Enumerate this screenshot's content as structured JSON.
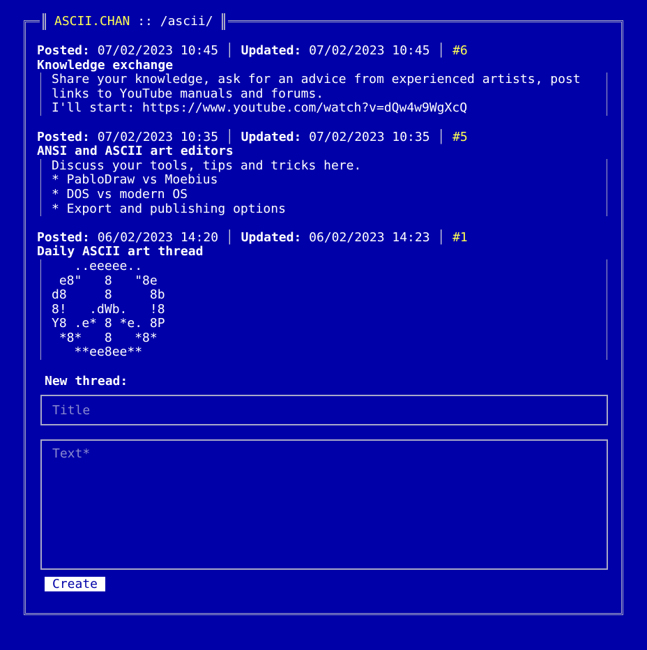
{
  "header": {
    "brand": "ASCII.CHAN",
    "separator": " :: ",
    "board": "/ascii/"
  },
  "labels": {
    "posted": "Posted:",
    "updated": "Updated:"
  },
  "threads": [
    {
      "posted": "07/02/2023 10:45",
      "updated": "07/02/2023 10:45",
      "number": "#6",
      "title": "Knowledge exchange",
      "body": "Share your knowledge, ask for an advice from experienced artists, post\nlinks to YouTube manuals and forums.\nI'll start: https://www.youtube.com/watch?v=dQw4w9WgXcQ"
    },
    {
      "posted": "07/02/2023 10:35",
      "updated": "07/02/2023 10:35",
      "number": "#5",
      "title": "ANSI and ASCII art editors",
      "body": "Discuss your tools, tips and tricks here.\n* PabloDraw vs Moebius\n* DOS vs modern OS\n* Export and publishing options"
    },
    {
      "posted": "06/02/2023 14:20",
      "updated": "06/02/2023 14:23",
      "number": "#1",
      "title": "Daily ASCII art thread",
      "body": "   ..eeeee..\n e8\"   8   \"8e\nd8     8     8b\n8!   .dWb.   !8\nY8 .e* 8 *e. 8P\n *8*   8   *8*\n   **ee8ee**"
    }
  ],
  "new_thread": {
    "label": "New thread:",
    "title_placeholder": "Title",
    "text_placeholder": "Text*",
    "create_label": "Create"
  },
  "colors": {
    "background": "#0000a8",
    "accent": "#ffff55",
    "border": "#a8a8c8"
  }
}
